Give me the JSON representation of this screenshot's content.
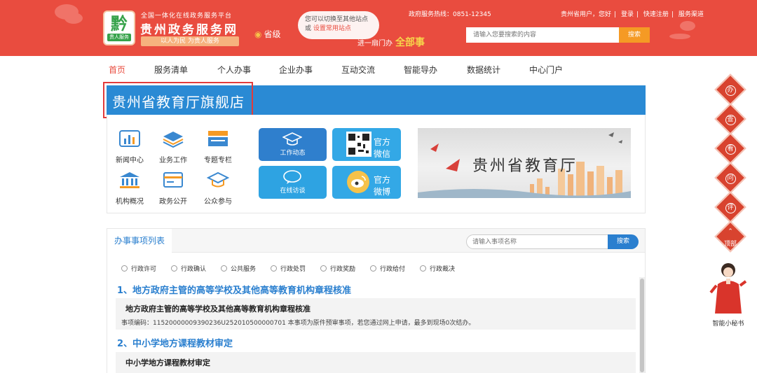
{
  "header": {
    "logo_tag": "贵人服务",
    "subtitle": "全国一体化在线政务服务平台",
    "title": "贵州政务服务网",
    "slogan": "以人为民  为贵人服务",
    "location": "省级",
    "bubble_line1": "您可以切换至其他站点",
    "bubble_line2_prefix": "或",
    "bubble_line2_link": "设置常用站点",
    "promo_prefix": "进一扇门办",
    "promo_highlight": "全部事",
    "hotline": "政府服务热线：0851-12345",
    "top_links": [
      "贵州省用户，您好",
      "登录",
      "快速注册",
      "服务渠道"
    ],
    "search_placeholder": "请输入您要搜索的内容",
    "search_button": "搜索"
  },
  "nav": {
    "items": [
      "首页",
      "服务清单",
      "个人办事",
      "企业办事",
      "互动交流",
      "智能导办",
      "数据统计",
      "中心门户"
    ]
  },
  "store": {
    "title": "贵州省教育厅旗舰店"
  },
  "features": {
    "icons": [
      "新闻中心",
      "业务工作",
      "专题专栏",
      "机构概况",
      "政务公开",
      "公众参与"
    ],
    "tile_work": "工作动态",
    "tile_interview": "在线访谈",
    "tile_wechat": "官方微信",
    "tile_weibo": "官方微博",
    "banner_text": "贵州省教育厅"
  },
  "list": {
    "tab": "办事事项列表",
    "search_placeholder": "请输入事项名称",
    "search_button": "搜索",
    "filters": [
      "行政许可",
      "行政确认",
      "公共服务",
      "行政处罚",
      "行政奖励",
      "行政给付",
      "行政裁决"
    ],
    "sections": [
      {
        "title": "1、地方政府主管的高等学校及其他高等教育机构章程核准",
        "item_name": "地方政府主管的高等学校及其他高等教育机构章程核准",
        "item_desc": "事项编码：11520000009390236U252010500000701 本事项为原件预审事项，若您通过网上申请，最多到现场0次结办。"
      },
      {
        "title": "2、中小学地方课程教材审定",
        "item_name": "中小学地方课程教材审定"
      }
    ]
  },
  "float_bar": {
    "items": [
      "办",
      "查",
      "看",
      "问",
      "评"
    ],
    "top_label": "顶部",
    "assistant_label": "智能小秘书"
  },
  "colors": {
    "header_red": "#e94c3f",
    "primary_blue": "#2a8ad4",
    "highlight_red": "#e23b3b",
    "search_orange": "#f59a24"
  }
}
